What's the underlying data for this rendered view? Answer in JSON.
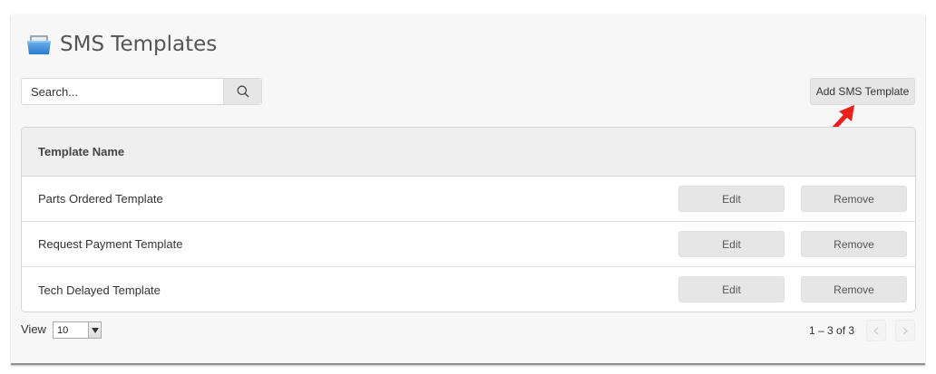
{
  "page": {
    "title": "SMS Templates",
    "title_icon": "folder-icon"
  },
  "search": {
    "placeholder": "Search...",
    "value": "",
    "icon": "search-icon"
  },
  "toolbar": {
    "add_label": "Add SMS Template"
  },
  "table": {
    "header": "Template Name",
    "rows": [
      {
        "name": "Parts Ordered Template",
        "edit": "Edit",
        "remove": "Remove"
      },
      {
        "name": "Request Payment Template",
        "edit": "Edit",
        "remove": "Remove"
      },
      {
        "name": "Tech Delayed Template",
        "edit": "Edit",
        "remove": "Remove"
      }
    ]
  },
  "footer": {
    "view_label": "View",
    "view_value": "10",
    "pagination": "1 – 3 of 3",
    "prev_icon": "chevron-left-icon",
    "next_icon": "chevron-right-icon"
  },
  "colors": {
    "annotation_arrow": "#e8211c",
    "folder_icon": "#3b8fd9"
  }
}
